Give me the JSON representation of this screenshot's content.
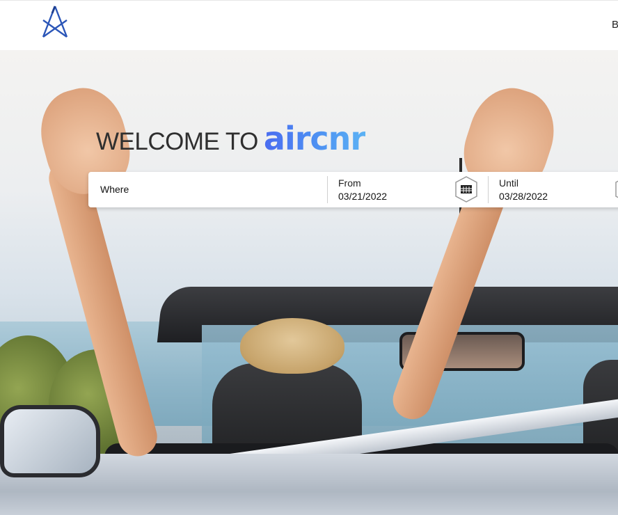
{
  "header": {
    "nav_item_partial": "B"
  },
  "hero": {
    "welcome_text": "WELCOME TO",
    "brand": "aircnr"
  },
  "search": {
    "where_label": "Where",
    "from": {
      "label": "From",
      "value": "03/21/2022"
    },
    "until": {
      "label": "Until",
      "value": "03/28/2022"
    }
  },
  "icons": [
    "logo-icon",
    "calendar-icon"
  ],
  "colors": {
    "brand_start": "#4a6cf0",
    "brand_end": "#5bb2f4",
    "logo": "#2b56b8"
  }
}
